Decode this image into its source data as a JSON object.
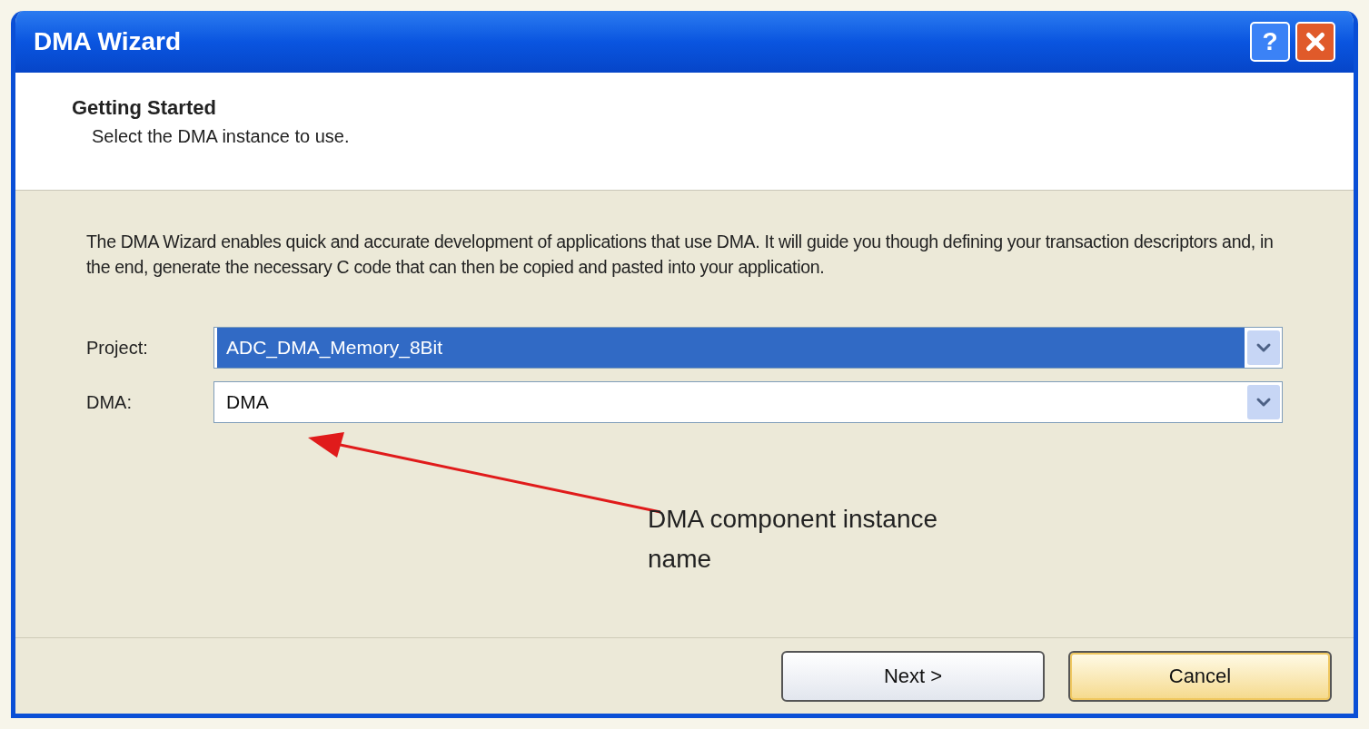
{
  "window": {
    "title": "DMA Wizard",
    "help_button": "?"
  },
  "header": {
    "title": "Getting Started",
    "subtitle": "Select the DMA instance to use."
  },
  "description": "The DMA Wizard enables quick and accurate development of applications that use DMA. It will guide you though defining your transaction descriptors and, in the end, generate the necessary C code that can then be copied and pasted into your application.",
  "fields": [
    {
      "label": "Project:",
      "value": "ADC_DMA_Memory_8Bit",
      "highlighted": true
    },
    {
      "label": "DMA:",
      "value": "DMA",
      "highlighted": false
    }
  ],
  "annotation": {
    "text": "DMA component instance name"
  },
  "buttons": [
    {
      "label": "Next >",
      "focused": false
    },
    {
      "label": "Cancel",
      "focused": true
    }
  ]
}
